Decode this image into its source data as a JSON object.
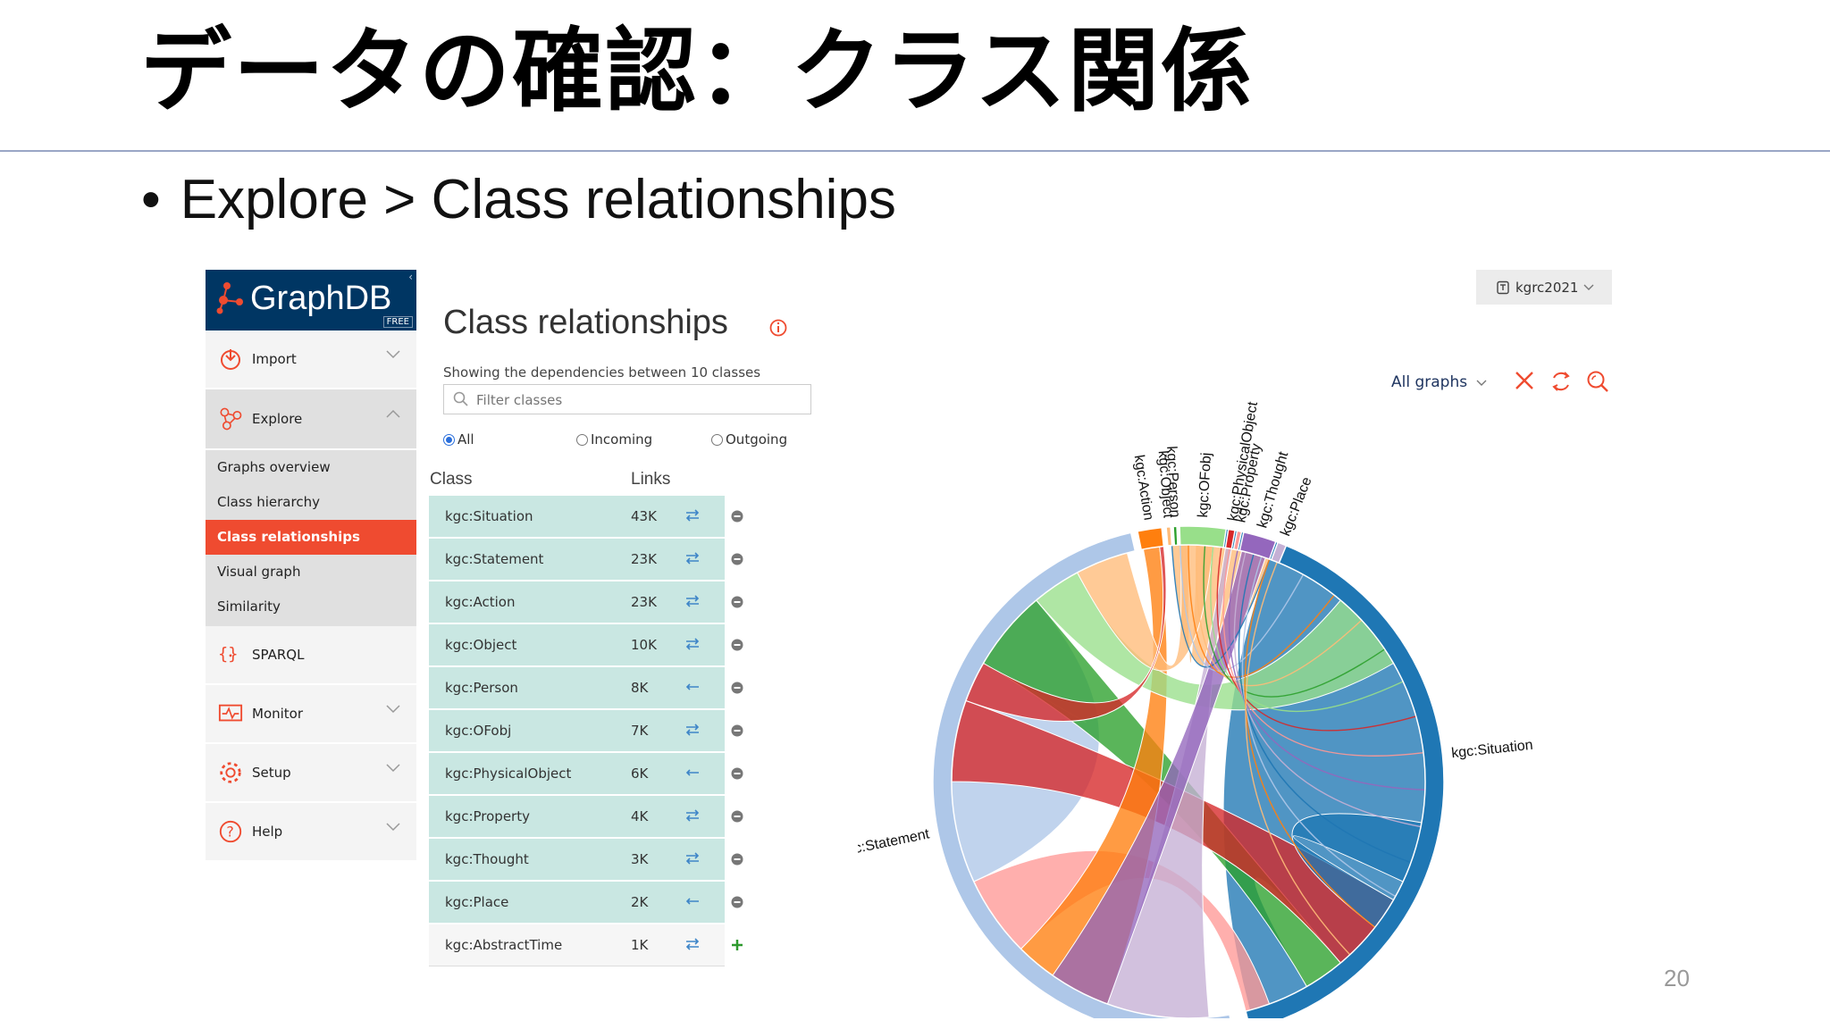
{
  "slide": {
    "title": "データの確認：クラス関係",
    "bullet": "Explore > Class relationships",
    "page_number": "20"
  },
  "sidebar": {
    "logo": "GraphDB",
    "badge": "FREE",
    "collapse": "‹",
    "groups": [
      {
        "label": "Import",
        "icon": "import-icon"
      },
      {
        "label": "Explore",
        "icon": "explore-icon"
      },
      {
        "label": "SPARQL",
        "icon": "sparql-icon"
      },
      {
        "label": "Monitor",
        "icon": "monitor-icon"
      },
      {
        "label": "Setup",
        "icon": "gear-icon"
      },
      {
        "label": "Help",
        "icon": "help-icon"
      }
    ],
    "explore_items": [
      "Graphs overview",
      "Class hierarchy",
      "Class relationships",
      "Visual graph",
      "Similarity"
    ],
    "active_item": "Class relationships"
  },
  "panel": {
    "title": "Class relationships",
    "subtitle": "Showing the dependencies between 10 classes",
    "filter_placeholder": "Filter classes",
    "radios": [
      "All",
      "Incoming",
      "Outgoing"
    ],
    "selected_radio": "All",
    "col_class": "Class",
    "col_links": "Links",
    "repository": "kgrc2021",
    "all_graphs": "All graphs"
  },
  "table": [
    {
      "cls": "kgc:Situation",
      "links": "43K",
      "dir": "⇄",
      "act": "⊖"
    },
    {
      "cls": "kgc:Statement",
      "links": "23K",
      "dir": "⇄",
      "act": "⊖"
    },
    {
      "cls": "kgc:Action",
      "links": "23K",
      "dir": "⇄",
      "act": "⊖"
    },
    {
      "cls": "kgc:Object",
      "links": "10K",
      "dir": "⇄",
      "act": "⊖"
    },
    {
      "cls": "kgc:Person",
      "links": "8K",
      "dir": "←",
      "act": "⊖"
    },
    {
      "cls": "kgc:OFobj",
      "links": "7K",
      "dir": "⇄",
      "act": "⊖"
    },
    {
      "cls": "kgc:PhysicalObject",
      "links": "6K",
      "dir": "←",
      "act": "⊖"
    },
    {
      "cls": "kgc:Property",
      "links": "4K",
      "dir": "⇄",
      "act": "⊖"
    },
    {
      "cls": "kgc:Thought",
      "links": "3K",
      "dir": "⇄",
      "act": "⊖"
    },
    {
      "cls": "kgc:Place",
      "links": "2K",
      "dir": "←",
      "act": "⊖"
    },
    {
      "cls": "kgc:AbstractTime",
      "links": "1K",
      "dir": "⇄",
      "act": "+"
    }
  ],
  "chord": {
    "labels": [
      "kgc:Situation",
      "kgc:Statement",
      "kgc:Action",
      "kgc:Object",
      "kgc:Person",
      "kgc:OFobj",
      "kgc:PhysicalObject",
      "kgc:Property",
      "kgc:Thought",
      "kgc:Place"
    ],
    "colors": [
      "#1f77b4",
      "#aec7e8",
      "#ff7f0e",
      "#ffbb78",
      "#2ca02c",
      "#98df8a",
      "#d62728",
      "#ff9896",
      "#9467bd",
      "#c5b0d5"
    ]
  },
  "colors": {
    "accent": "#ef4b30",
    "logo_bg": "#003663",
    "row_bg": "#c9e7e2"
  }
}
